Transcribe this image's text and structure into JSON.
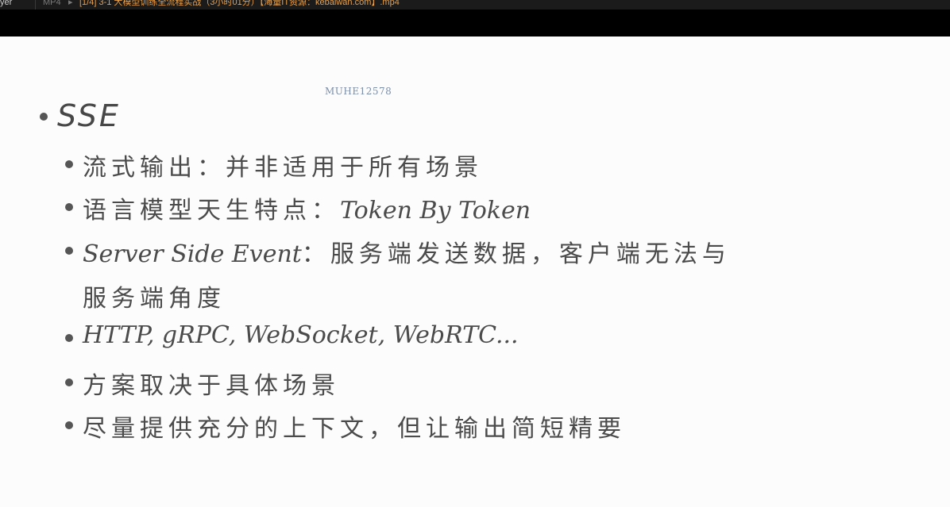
{
  "window": {
    "app_label": "yer",
    "format": "MP4",
    "arrow": "▸",
    "file_title": "[1/4] 3-1 大模型训练全流程实战（3小时01分）【海量IT资源：kebaiwan.com】.mp4"
  },
  "slide": {
    "watermark": "MUHE12578",
    "heading": "SSE",
    "items": [
      {
        "text": "流式输出：并非适用于所有场景"
      },
      {
        "text": "语言模型天生特点：",
        "latin": "Token By Token"
      },
      {
        "latin": "Server Side Event",
        "text": "：服务端发送数据，客户端无法与"
      },
      {
        "text": "服务端角度"
      },
      {
        "latin": "HTTP, gRPC, WebSocket, WebRTC..."
      },
      {
        "text": "方案取决于具体场景"
      },
      {
        "text": "尽量提供充分的上下文，但让输出简短精要"
      }
    ]
  },
  "colors": {
    "background": "#fcfcfc",
    "text": "#4b4b4b",
    "watermark": "#7d8fa8",
    "title_accent": "#e8a04a"
  }
}
